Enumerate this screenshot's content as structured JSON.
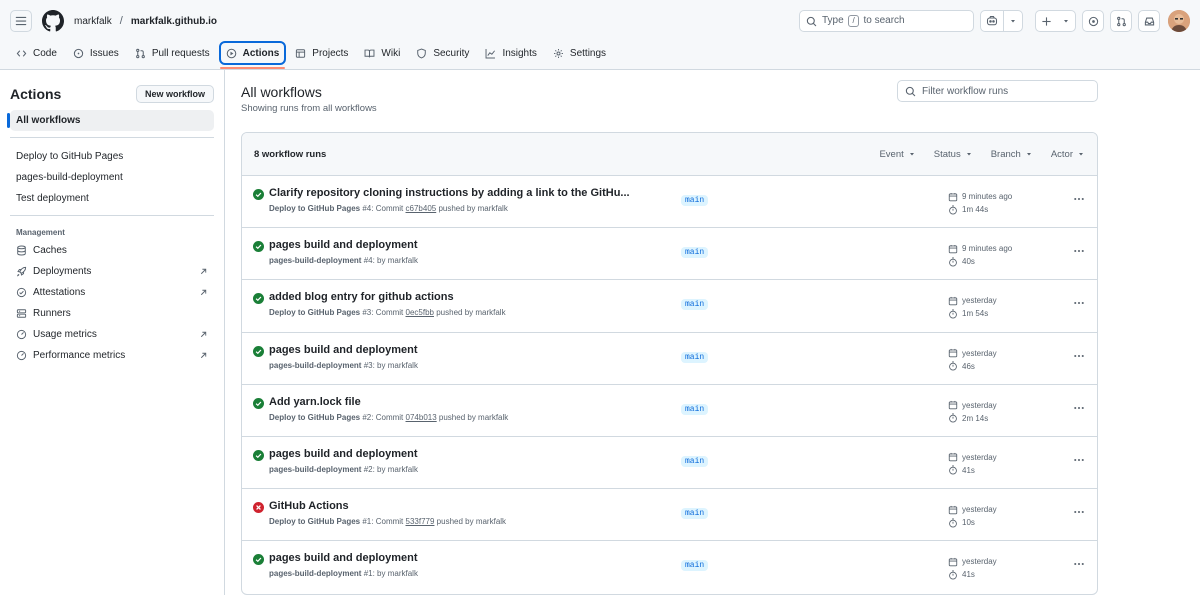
{
  "header": {
    "owner": "markfalk",
    "separator": "/",
    "repo": "markfalk.github.io",
    "search_placeholder_prefix": "Type",
    "search_key": "/",
    "search_placeholder_suffix": "to search"
  },
  "tabs": [
    {
      "label": "Code",
      "icon": "code-icon"
    },
    {
      "label": "Issues",
      "icon": "issue-icon"
    },
    {
      "label": "Pull requests",
      "icon": "pull-request-icon"
    },
    {
      "label": "Actions",
      "icon": "play-icon",
      "active": true
    },
    {
      "label": "Projects",
      "icon": "table-icon"
    },
    {
      "label": "Wiki",
      "icon": "book-icon"
    },
    {
      "label": "Security",
      "icon": "shield-icon"
    },
    {
      "label": "Insights",
      "icon": "graph-icon"
    },
    {
      "label": "Settings",
      "icon": "gear-icon"
    }
  ],
  "sidebar": {
    "title": "Actions",
    "new_workflow": "New workflow",
    "all_workflows": "All workflows",
    "workflows": [
      "Deploy to GitHub Pages",
      "pages-build-deployment",
      "Test deployment"
    ],
    "management_label": "Management",
    "management": [
      {
        "label": "Caches",
        "icon": "database-icon",
        "external": false
      },
      {
        "label": "Deployments",
        "icon": "rocket-icon",
        "external": true
      },
      {
        "label": "Attestations",
        "icon": "verified-icon",
        "external": true
      },
      {
        "label": "Runners",
        "icon": "server-icon",
        "external": false
      },
      {
        "label": "Usage metrics",
        "icon": "meter-icon",
        "external": true
      },
      {
        "label": "Performance metrics",
        "icon": "meter-icon",
        "external": true
      }
    ]
  },
  "main": {
    "title": "All workflows",
    "subtitle": "Showing runs from all workflows",
    "filter_placeholder": "Filter workflow runs",
    "run_count": "8 workflow runs",
    "filters": [
      "Event",
      "Status",
      "Branch",
      "Actor"
    ]
  },
  "runs": [
    {
      "status": "success",
      "title": "Clarify repository cloning instructions by adding a link to the GitHu...",
      "workflow": "Deploy to GitHub Pages",
      "number": "#4",
      "pre": "Commit",
      "sha": "c67b405",
      "post": "pushed by markfalk",
      "branch": "main",
      "when": "9 minutes ago",
      "duration": "1m 44s"
    },
    {
      "status": "success",
      "title": "pages build and deployment",
      "workflow": "pages-build-deployment",
      "number": "#4",
      "pre": "",
      "sha": "",
      "post": "by markfalk",
      "branch": "main",
      "when": "9 minutes ago",
      "duration": "40s"
    },
    {
      "status": "success",
      "title": "added blog entry for github actions",
      "workflow": "Deploy to GitHub Pages",
      "number": "#3",
      "pre": "Commit",
      "sha": "0ec5fbb",
      "post": "pushed by markfalk",
      "branch": "main",
      "when": "yesterday",
      "duration": "1m 54s"
    },
    {
      "status": "success",
      "title": "pages build and deployment",
      "workflow": "pages-build-deployment",
      "number": "#3",
      "pre": "",
      "sha": "",
      "post": "by markfalk",
      "branch": "main",
      "when": "yesterday",
      "duration": "46s"
    },
    {
      "status": "success",
      "title": "Add yarn.lock file",
      "workflow": "Deploy to GitHub Pages",
      "number": "#2",
      "pre": "Commit",
      "sha": "074b013",
      "post": "pushed by markfalk",
      "branch": "main",
      "when": "yesterday",
      "duration": "2m 14s"
    },
    {
      "status": "success",
      "title": "pages build and deployment",
      "workflow": "pages-build-deployment",
      "number": "#2",
      "pre": "",
      "sha": "",
      "post": "by markfalk",
      "branch": "main",
      "when": "yesterday",
      "duration": "41s"
    },
    {
      "status": "failure",
      "title": "GitHub Actions",
      "workflow": "Deploy to GitHub Pages",
      "number": "#1",
      "pre": "Commit",
      "sha": "533f779",
      "post": "pushed by markfalk",
      "branch": "main",
      "when": "yesterday",
      "duration": "10s"
    },
    {
      "status": "success",
      "title": "pages build and deployment",
      "workflow": "pages-build-deployment",
      "number": "#1",
      "pre": "",
      "sha": "",
      "post": "by markfalk",
      "branch": "main",
      "when": "yesterday",
      "duration": "41s"
    }
  ],
  "colors": {
    "success": "#1a7f37",
    "failure": "#cf222e",
    "accent": "#0969da",
    "underline": "#fd8c73"
  }
}
